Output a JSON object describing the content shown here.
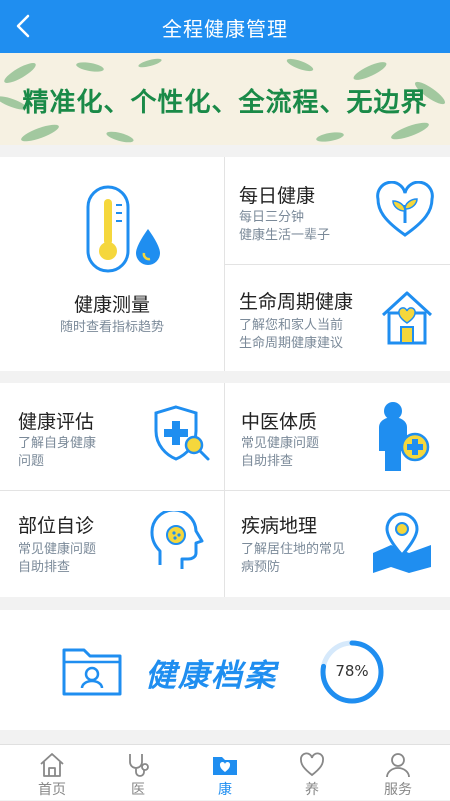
{
  "header": {
    "title": "全程健康管理"
  },
  "banner": {
    "text": "精准化、个性化、全流程、无边界"
  },
  "measure": {
    "title": "健康测量",
    "subtitle": "随时查看指标趋势"
  },
  "daily": {
    "title": "每日健康",
    "sub1": "每日三分钟",
    "sub2": "健康生活一辈子"
  },
  "lifecycle": {
    "title": "生命周期健康",
    "sub1": "了解您和家人当前",
    "sub2": "生命周期健康建议"
  },
  "assess": {
    "title": "健康评估",
    "sub1": "了解自身健康",
    "sub2": "问题"
  },
  "tcm": {
    "title": "中医体质",
    "sub1": "常见健康问题",
    "sub2": "自助排查"
  },
  "body": {
    "title": "部位自诊",
    "sub1": "常见健康问题",
    "sub2": "自助排查"
  },
  "geo": {
    "title": "疾病地理",
    "sub1": "了解居住地的常见",
    "sub2": "病预防"
  },
  "archive": {
    "title": "健康档案",
    "percent_label": "78%",
    "percent": 78
  },
  "tabs": [
    {
      "label": "首页",
      "icon": "home-icon"
    },
    {
      "label": "医",
      "icon": "stethoscope-icon"
    },
    {
      "label": "康",
      "icon": "health-folder-icon"
    },
    {
      "label": "养",
      "icon": "heart-icon"
    },
    {
      "label": "服务",
      "icon": "user-icon"
    }
  ],
  "colors": {
    "primary": "#1f8ef0",
    "accent": "#f5d73c",
    "banner_text": "#1a8a48"
  }
}
